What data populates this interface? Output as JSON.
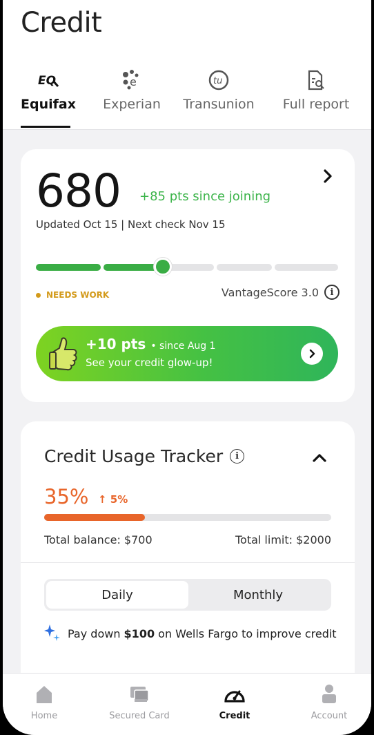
{
  "header": {
    "title": "Credit"
  },
  "tabs": [
    {
      "label": "Equifax",
      "icon": "equifax-logo-icon",
      "active": true
    },
    {
      "label": "Experian",
      "icon": "experian-logo-icon",
      "active": false
    },
    {
      "label": "Transunion",
      "icon": "transunion-logo-icon",
      "active": false
    },
    {
      "label": "Full report",
      "icon": "report-search-icon",
      "active": false
    }
  ],
  "score_card": {
    "score": "680",
    "since_joining": "+85 pts since joining",
    "updated": "Updated Oct 15 | Next check Nov 15",
    "status": "NEEDS WORK",
    "model": "VantageScore 3.0",
    "progress_fraction": 0.42,
    "colors": {
      "good": "#3aad45",
      "status": "#d39a1a"
    },
    "glow_up": {
      "points": "+10 pts",
      "since": "• since Aug 1",
      "message": "See your credit glow-up!"
    }
  },
  "usage_card": {
    "title": "Credit Usage Tracker",
    "percent": "35%",
    "change": "↑ 5%",
    "usage_fraction": 0.35,
    "total_balance": "Total balance: $700",
    "total_limit": "Total limit: $2000",
    "toggle": {
      "options": [
        "Daily",
        "Monthly"
      ],
      "selected": "Daily"
    },
    "tip": {
      "prefix": "Pay down ",
      "amount": "$100",
      "suffix": " on Wells Fargo to improve credit"
    },
    "accent": "#e8652a"
  },
  "bottom_nav": [
    {
      "label": "Home",
      "icon": "home-icon",
      "active": false
    },
    {
      "label": "Secured Card",
      "icon": "card-icon",
      "active": false
    },
    {
      "label": "Credit",
      "icon": "gauge-icon",
      "active": true
    },
    {
      "label": "Account",
      "icon": "person-icon",
      "active": false
    }
  ]
}
